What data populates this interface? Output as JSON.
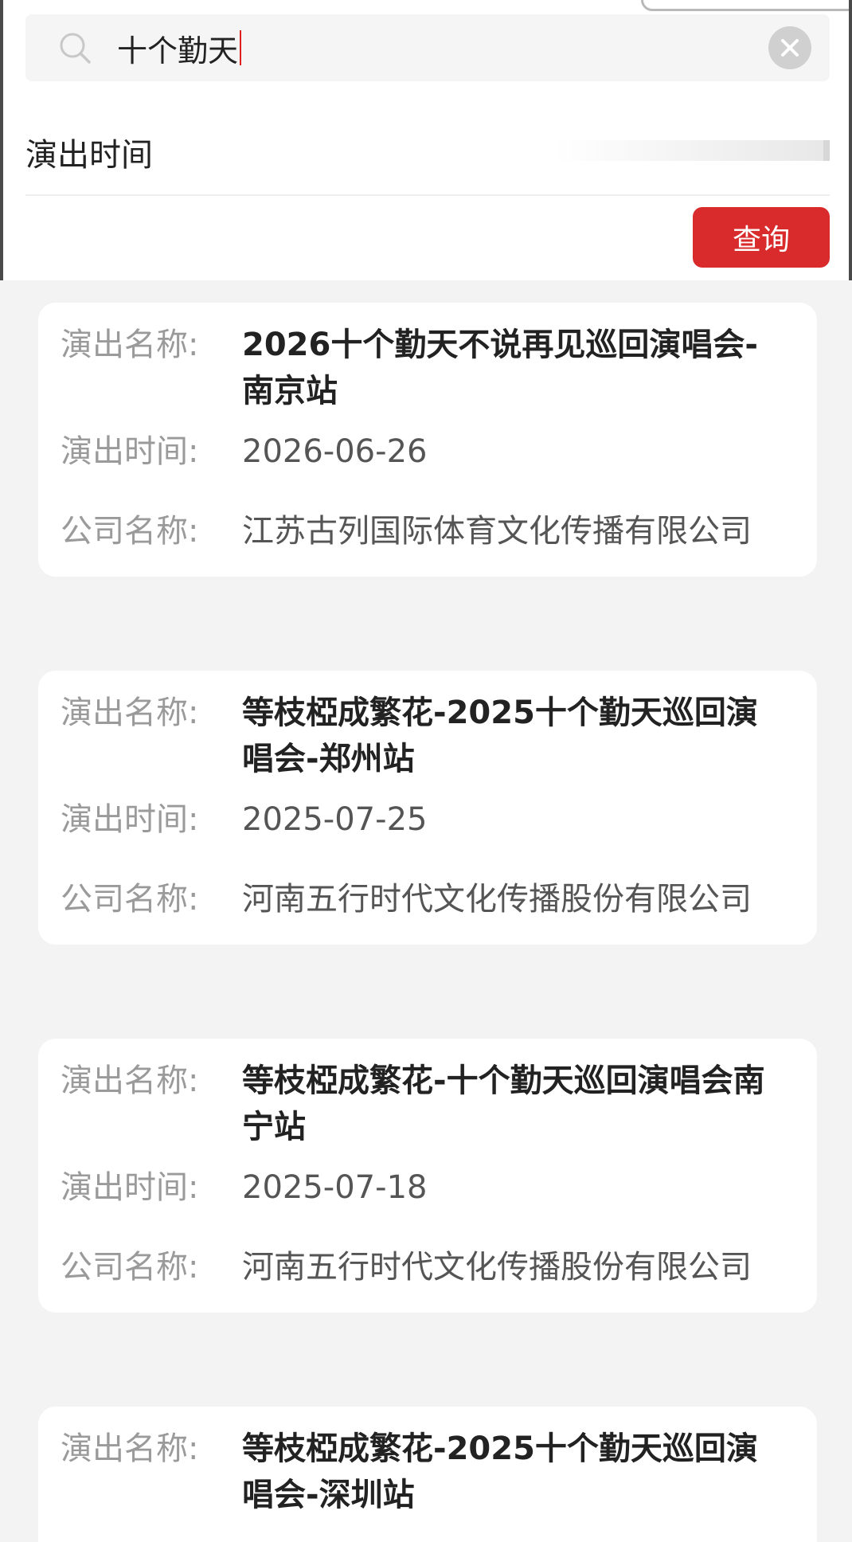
{
  "search": {
    "query": "十个勤天"
  },
  "filter": {
    "label": "演出时间"
  },
  "query_button": {
    "label": "查询"
  },
  "labels": {
    "name": "演出名称:",
    "time": "演出时间:",
    "company": "公司名称:"
  },
  "results": [
    {
      "name": "2026十个勤天不说再见巡回演唱会-南京站",
      "date": "2026-06-26",
      "company": "江苏古列国际体育文化传播有限公司"
    },
    {
      "name": "等枝椏成繁花-2025十个勤天巡回演唱会-郑州站",
      "date": "2025-07-25",
      "company": "河南五行时代文化传播股份有限公司"
    },
    {
      "name": "等枝椏成繁花-十个勤天巡回演唱会南宁站",
      "date": "2025-07-18",
      "company": "河南五行时代文化传播股份有限公司"
    },
    {
      "name": "等枝椏成繁花-2025十个勤天巡回演唱会-深圳站"
    }
  ],
  "colors": {
    "accent": "#d92b2b",
    "background": "#f3f3f3",
    "card": "#ffffff"
  }
}
